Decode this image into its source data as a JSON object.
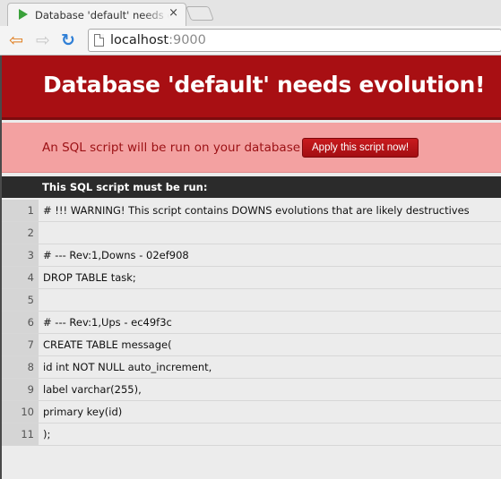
{
  "browser": {
    "tab_title": "Database 'default' needs evolution!",
    "tab_close": "×",
    "url_host": "localhost",
    "url_port": ":9000"
  },
  "page": {
    "title": "Database 'default' needs evolution!",
    "notice": "An SQL script will be run on your database -",
    "apply_button": "Apply this script now!",
    "script_header": "This SQL script must be run:",
    "lines": [
      {
        "n": "1",
        "text": "# !!! WARNING! This script contains DOWNS evolutions that are likely destructives"
      },
      {
        "n": "2",
        "text": ""
      },
      {
        "n": "3",
        "text": "# --- Rev:1,Downs - 02ef908"
      },
      {
        "n": "4",
        "text": "DROP TABLE task;"
      },
      {
        "n": "5",
        "text": ""
      },
      {
        "n": "6",
        "text": "# --- Rev:1,Ups - ec49f3c"
      },
      {
        "n": "7",
        "text": "CREATE TABLE message("
      },
      {
        "n": "8",
        "text": "id int NOT NULL auto_increment,"
      },
      {
        "n": "9",
        "text": "label varchar(255),"
      },
      {
        "n": "10",
        "text": "primary key(id)"
      },
      {
        "n": "11",
        "text": ");"
      }
    ]
  },
  "icons": {
    "tab": "play-icon",
    "back": "back-arrow-icon",
    "forward": "forward-arrow-icon",
    "reload": "reload-icon",
    "page": "page-icon"
  },
  "colors": {
    "header": "#a80f13",
    "notice": "#f3a1a1",
    "button": "#b81418",
    "script_bar": "#2b2b2b"
  }
}
